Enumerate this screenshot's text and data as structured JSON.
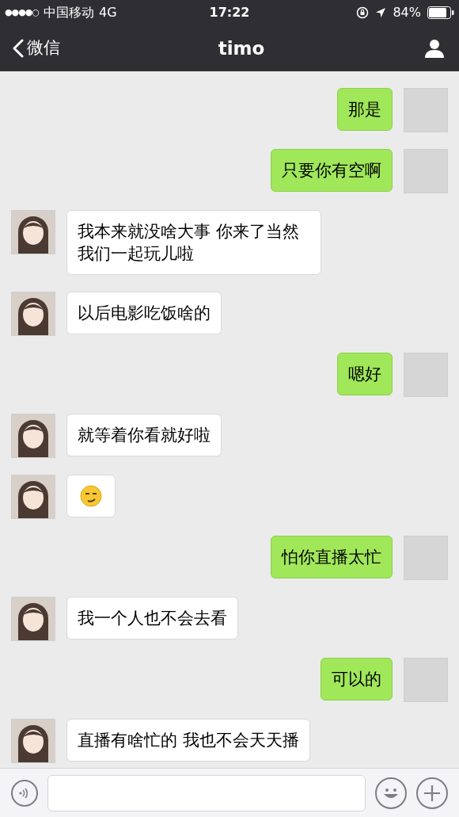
{
  "status_bar": {
    "signal_dots": "●●●●○",
    "carrier": "中国移动",
    "network": "4G",
    "time": "17:22",
    "battery": "84%"
  },
  "nav_bar": {
    "back_label": "微信",
    "title": "timo"
  },
  "messages": [
    {
      "outgoing": true,
      "kind": "text",
      "text": "那是"
    },
    {
      "outgoing": true,
      "kind": "text",
      "text": "只要你有空啊"
    },
    {
      "outgoing": false,
      "kind": "text",
      "text": "我本来就没啥大事 你来了当然我们一起玩儿啦"
    },
    {
      "outgoing": false,
      "kind": "text",
      "text": "以后电影吃饭啥的"
    },
    {
      "outgoing": true,
      "kind": "text",
      "text": "嗯好"
    },
    {
      "outgoing": false,
      "kind": "text",
      "text": "就等着你看就好啦"
    },
    {
      "outgoing": false,
      "kind": "emoji"
    },
    {
      "outgoing": true,
      "kind": "text",
      "text": "怕你直播太忙"
    },
    {
      "outgoing": false,
      "kind": "text",
      "text": "我一个人也不会去看"
    },
    {
      "outgoing": true,
      "kind": "text",
      "text": "可以的"
    },
    {
      "outgoing": false,
      "kind": "text",
      "text": "直播有啥忙的 我也不会天天播"
    }
  ]
}
